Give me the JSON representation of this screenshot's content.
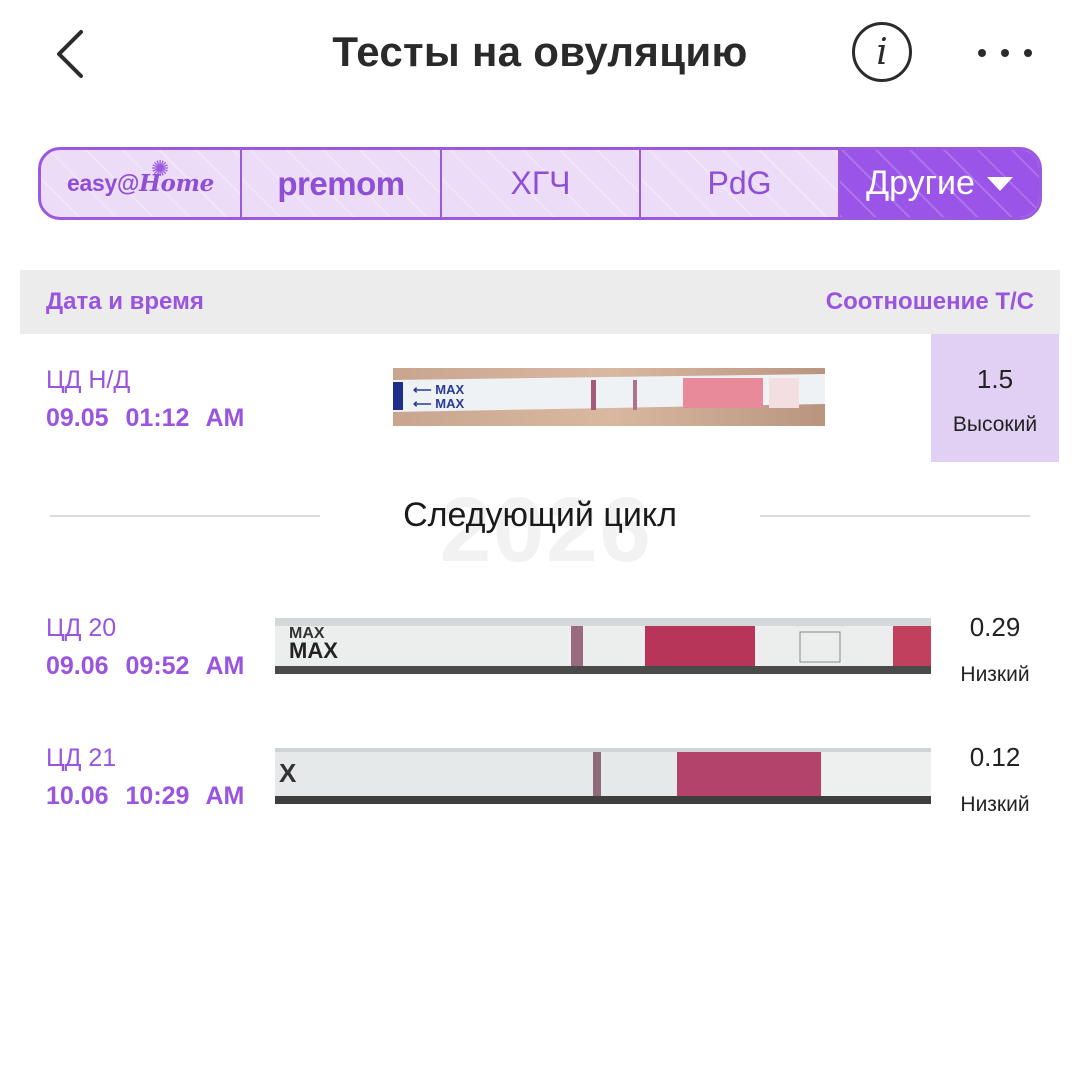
{
  "header": {
    "title": "Тесты на овуляцию",
    "info_glyph": "i"
  },
  "tabs": {
    "easy_home": {
      "part1": "easy",
      "at": "@",
      "part2": "Home"
    },
    "premom": "premom",
    "hcg": "ХГЧ",
    "pdg": "PdG",
    "other": "Другие"
  },
  "colors": {
    "accent": "#9a55e0",
    "accent_light": "#e2cff4",
    "tab_selected": "#9a55e8"
  },
  "columns": {
    "date_time": "Дата и время",
    "ratio": "Соотношение Т/С"
  },
  "divider": {
    "label": "Следующий цикл",
    "watermark": "2026"
  },
  "rows": [
    {
      "cycle_day": "ЦД Н/Д",
      "date": "09.05",
      "time": "01:12 AM",
      "ratio": "1.5",
      "level": "Высокий",
      "strip_marker": "MAX"
    },
    {
      "cycle_day": "ЦД 20",
      "date": "09.06",
      "time": "09:52 AM",
      "ratio": "0.29",
      "level": "Низкий",
      "strip_marker": "MAX"
    },
    {
      "cycle_day": "ЦД 21",
      "date": "10.06",
      "time": "10:29 AM",
      "ratio": "0.12",
      "level": "Низкий",
      "strip_marker": "X"
    }
  ]
}
